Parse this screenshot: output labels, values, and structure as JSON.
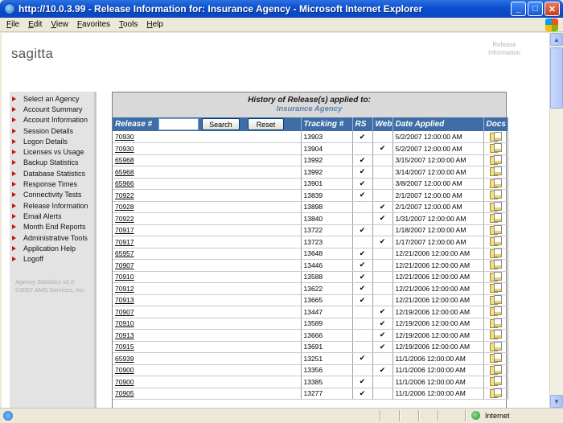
{
  "window": {
    "title": "http://10.0.3.99 - Release Information for: Insurance Agency - Microsoft Internet Explorer"
  },
  "menu": [
    "File",
    "Edit",
    "View",
    "Favorites",
    "Tools",
    "Help"
  ],
  "page": {
    "logo": "sagitta",
    "caption": "Release Information"
  },
  "sidebar": {
    "items": [
      "Select an Agency",
      "Account Summary",
      "Account Information",
      "Session Details",
      "Logon Details",
      "Licenses vs Usage",
      "Backup Statistics",
      "Database Statistics",
      "Response Times",
      "Connectivity Tests",
      "Release Information",
      "Email Alerts",
      "Month End Reports",
      "Administrative Tools",
      "Application Help",
      "Logoff"
    ],
    "footer_line1": "Agency Statistics v2.0",
    "footer_line2": "©2007 AMS Services, Inc."
  },
  "history": {
    "title": "History of Release(s) applied to:",
    "agency": "Insurance Agency",
    "search_value": "",
    "search_label": "Search",
    "reset_label": "Reset",
    "columns": {
      "release": "Release #",
      "tracking": "Tracking #",
      "rs": "RS",
      "web": "Web",
      "date": "Date Applied",
      "docs": "Docs"
    },
    "rows": [
      {
        "release": "70930",
        "tracking": "13903",
        "rs": true,
        "web": false,
        "date": "5/2/2007 12:00:00 AM"
      },
      {
        "release": "70930",
        "tracking": "13904",
        "rs": false,
        "web": true,
        "date": "5/2/2007 12:00:00 AM"
      },
      {
        "release": "65968",
        "tracking": "13992",
        "rs": true,
        "web": false,
        "date": "3/15/2007 12:00:00 AM"
      },
      {
        "release": "65968",
        "tracking": "13992",
        "rs": true,
        "web": false,
        "date": "3/14/2007 12:00:00 AM"
      },
      {
        "release": "65966",
        "tracking": "13901",
        "rs": true,
        "web": false,
        "date": "3/8/2007 12:00:00 AM"
      },
      {
        "release": "70922",
        "tracking": "13839",
        "rs": true,
        "web": false,
        "date": "2/1/2007 12:00:00 AM"
      },
      {
        "release": "70928",
        "tracking": "13898",
        "rs": false,
        "web": true,
        "date": "2/1/2007 12:00:00 AM"
      },
      {
        "release": "70922",
        "tracking": "13840",
        "rs": false,
        "web": true,
        "date": "1/31/2007 12:00:00 AM"
      },
      {
        "release": "70917",
        "tracking": "13722",
        "rs": true,
        "web": false,
        "date": "1/18/2007 12:00:00 AM"
      },
      {
        "release": "70917",
        "tracking": "13723",
        "rs": false,
        "web": true,
        "date": "1/17/2007 12:00:00 AM"
      },
      {
        "release": "65957",
        "tracking": "13648",
        "rs": true,
        "web": false,
        "date": "12/21/2006 12:00:00 AM"
      },
      {
        "release": "70907",
        "tracking": "13446",
        "rs": true,
        "web": false,
        "date": "12/21/2006 12:00:00 AM"
      },
      {
        "release": "70910",
        "tracking": "13588",
        "rs": true,
        "web": false,
        "date": "12/21/2006 12:00:00 AM"
      },
      {
        "release": "70912",
        "tracking": "13622",
        "rs": true,
        "web": false,
        "date": "12/21/2006 12:00:00 AM"
      },
      {
        "release": "70913",
        "tracking": "13665",
        "rs": true,
        "web": false,
        "date": "12/21/2006 12:00:00 AM"
      },
      {
        "release": "70907",
        "tracking": "13447",
        "rs": false,
        "web": true,
        "date": "12/19/2006 12:00:00 AM"
      },
      {
        "release": "70910",
        "tracking": "13589",
        "rs": false,
        "web": true,
        "date": "12/19/2006 12:00:00 AM"
      },
      {
        "release": "70913",
        "tracking": "13666",
        "rs": false,
        "web": true,
        "date": "12/19/2006 12:00:00 AM"
      },
      {
        "release": "70915",
        "tracking": "13691",
        "rs": false,
        "web": true,
        "date": "12/19/2006 12:00:00 AM"
      },
      {
        "release": "65939",
        "tracking": "13251",
        "rs": true,
        "web": false,
        "date": "11/1/2006 12:00:00 AM"
      },
      {
        "release": "70900",
        "tracking": "13356",
        "rs": false,
        "web": true,
        "date": "11/1/2006 12:00:00 AM"
      },
      {
        "release": "70900",
        "tracking": "13385",
        "rs": true,
        "web": false,
        "date": "11/1/2006 12:00:00 AM"
      },
      {
        "release": "70905",
        "tracking": "13277",
        "rs": true,
        "web": false,
        "date": "11/1/2006 12:00:00 AM"
      }
    ]
  },
  "status": {
    "zone": "Internet"
  },
  "icons": {
    "check": "✔",
    "docs": "documents-icon"
  }
}
